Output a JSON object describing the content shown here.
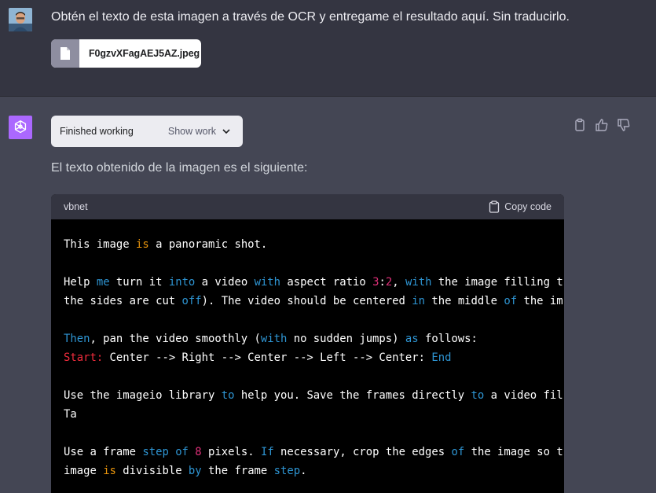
{
  "user_message": {
    "text": "Obtén el texto de esta imagen a través de OCR y entregame el resultado aquí. Sin traducirlo.",
    "attachment_name": "F0gzvXFagAEJ5AZ.jpeg"
  },
  "assistant": {
    "work_status": "Finished working",
    "show_work_label": "Show work",
    "intro": "El texto obtenido de la imagen es el siguiente:",
    "code": {
      "language": "vbnet",
      "copy_label": "Copy code",
      "lines": [
        [
          [
            "t",
            "This image "
          ],
          [
            "or",
            "is"
          ],
          [
            "t",
            " a panoramic shot."
          ]
        ],
        [],
        [
          [
            "t",
            "Help "
          ],
          [
            "kw",
            "me"
          ],
          [
            "t",
            " turn it "
          ],
          [
            "kw",
            "into"
          ],
          [
            "t",
            " a video "
          ],
          [
            "kw",
            "with"
          ],
          [
            "t",
            " aspect ratio "
          ],
          [
            "rd",
            "3"
          ],
          [
            "t",
            ":"
          ],
          [
            "rd",
            "2"
          ],
          [
            "t",
            ", "
          ],
          [
            "kw",
            "with"
          ],
          [
            "t",
            " the image filling t"
          ]
        ],
        [
          [
            "t",
            "the sides are cut "
          ],
          [
            "kw",
            "off"
          ],
          [
            "t",
            "). The video should be centered "
          ],
          [
            "kw",
            "in"
          ],
          [
            "t",
            " the middle "
          ],
          [
            "kw",
            "of"
          ],
          [
            "t",
            " the im"
          ]
        ],
        [],
        [
          [
            "kw",
            "Then"
          ],
          [
            "t",
            ", pan the video smoothly ("
          ],
          [
            "kw",
            "with"
          ],
          [
            "t",
            " no sudden jumps) "
          ],
          [
            "kw",
            "as"
          ],
          [
            "t",
            " follows:"
          ]
        ],
        [
          [
            "st",
            "Start:"
          ],
          [
            "t",
            " Center --> Right --> Center --> Left --> Center: "
          ],
          [
            "kw",
            "End"
          ]
        ],
        [],
        [
          [
            "t",
            "Use the imageio library "
          ],
          [
            "kw",
            "to"
          ],
          [
            "t",
            " help you. Save the frames directly "
          ],
          [
            "kw",
            "to"
          ],
          [
            "t",
            " a video fil"
          ]
        ],
        [
          [
            "t",
            "Ta"
          ]
        ],
        [],
        [
          [
            "t",
            "Use a frame "
          ],
          [
            "kw",
            "step"
          ],
          [
            "t",
            " "
          ],
          [
            "kw",
            "of"
          ],
          [
            "t",
            " "
          ],
          [
            "rd",
            "8"
          ],
          [
            "t",
            " pixels. "
          ],
          [
            "kw",
            "If"
          ],
          [
            "t",
            " necessary, crop the edges "
          ],
          [
            "kw",
            "of"
          ],
          [
            "t",
            " the image so t"
          ]
        ],
        [
          [
            "t",
            "image "
          ],
          [
            "or",
            "is"
          ],
          [
            "t",
            " divisible "
          ],
          [
            "kw",
            "by"
          ],
          [
            "t",
            " the frame "
          ],
          [
            "kw",
            "step"
          ],
          [
            "t",
            "."
          ]
        ]
      ]
    }
  },
  "colors": {
    "user_bg": "#343541",
    "assistant_bg": "#444654",
    "code_bg": "#000000",
    "gpt_avatar": "#ab68ff",
    "keyword": "#2e95d3",
    "number": "#df3079",
    "operator": "#e9950c"
  }
}
